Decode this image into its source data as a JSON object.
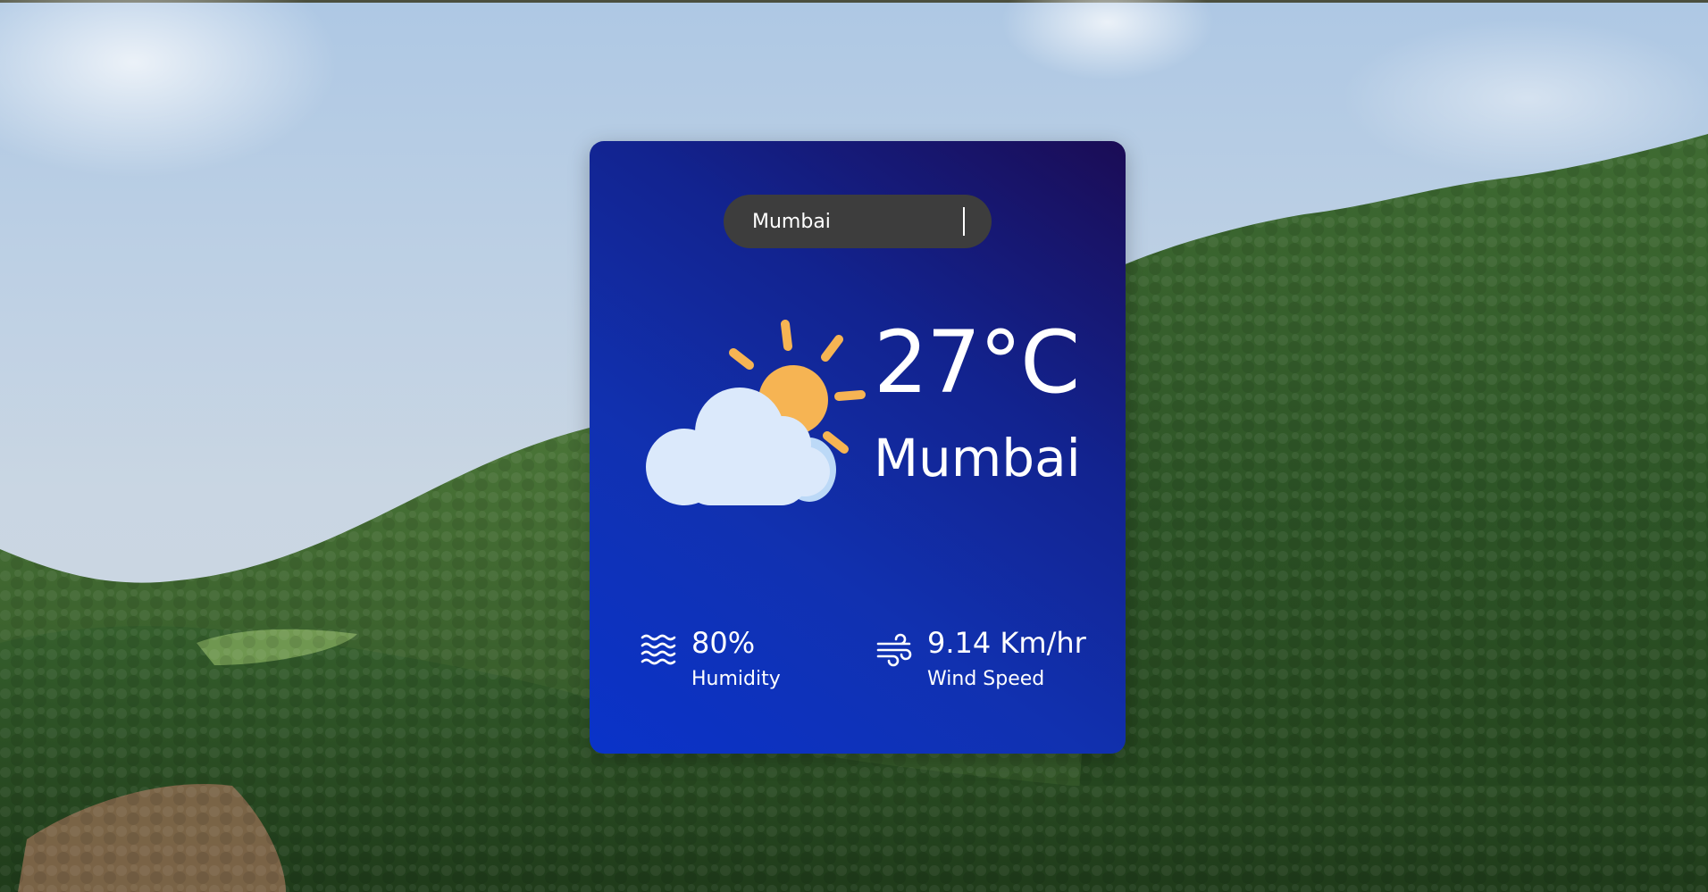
{
  "search": {
    "value": "Mumbai",
    "placeholder": ""
  },
  "weather": {
    "icon": "partly-cloudy-icon",
    "temperature": "27°C",
    "city": "Mumbai"
  },
  "stats": {
    "humidity": {
      "icon": "humidity-waves-icon",
      "value": "80%",
      "label": "Humidity"
    },
    "wind": {
      "icon": "wind-icon",
      "value": "9.14 Km/hr",
      "label": "Wind Speed"
    }
  },
  "colors": {
    "card_gradient_start": "#0a33c9",
    "card_gradient_end": "#1b0c55",
    "search_bg": "#3d3d3d",
    "sun": "#f6b453",
    "cloud": "#dbe9fb",
    "text": "#ffffff"
  }
}
